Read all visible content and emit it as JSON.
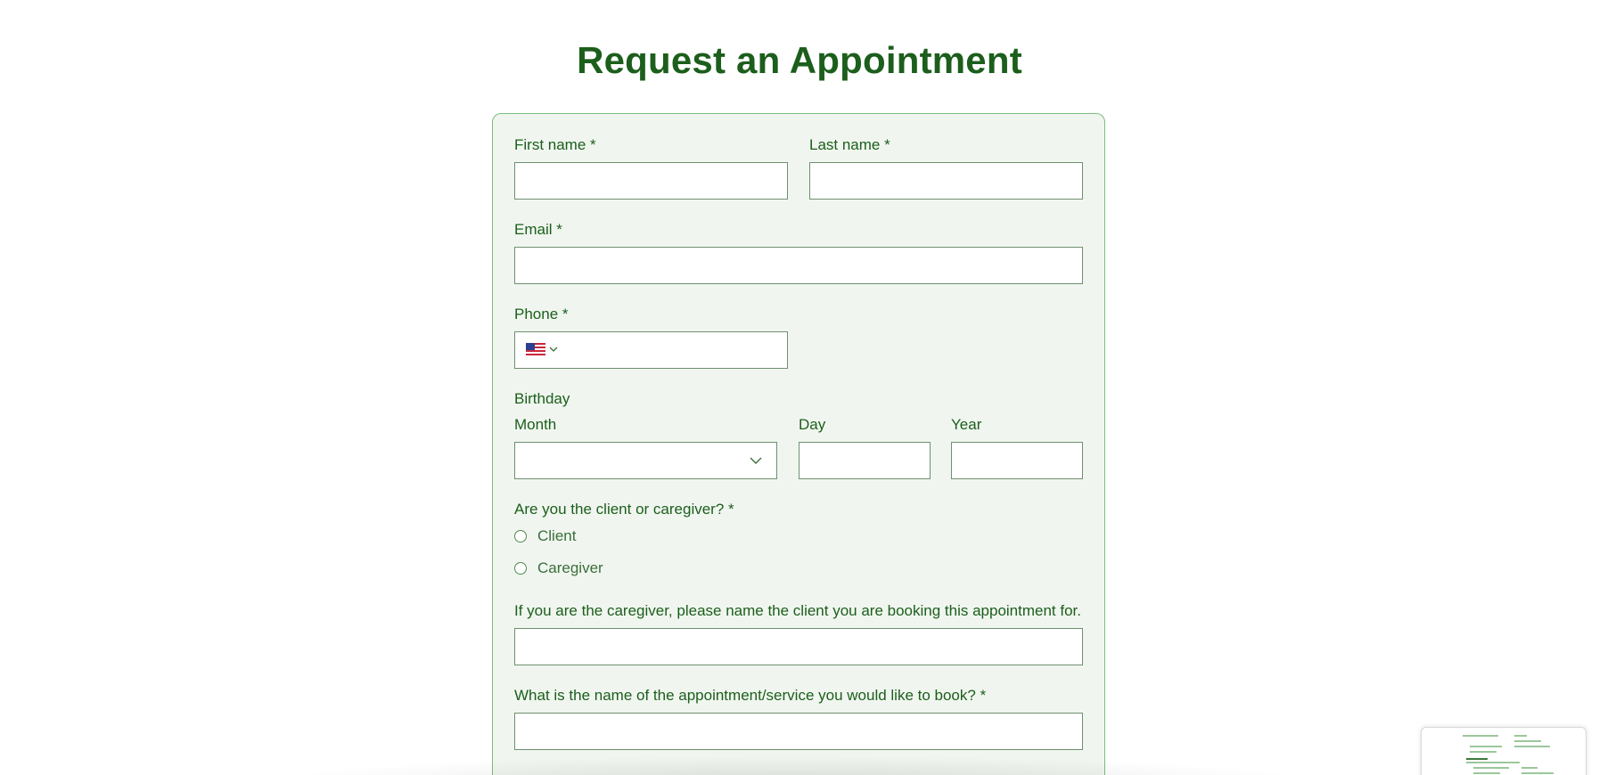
{
  "page": {
    "title": "Request an Appointment"
  },
  "form": {
    "first_name_label": "First name *",
    "last_name_label": "Last name *",
    "email_label": "Email *",
    "phone_label": "Phone *",
    "phone_country": "US",
    "birthday_label": "Birthday",
    "month_label": "Month",
    "day_label": "Day",
    "year_label": "Year",
    "role_question": "Are you the client or caregiver? *",
    "role_options": [
      "Client",
      "Caregiver"
    ],
    "caregiver_client_label": "If you are the caregiver, please name the client you are booking this appointment for.",
    "service_label": "What is the name of the appointment/service you would like to book? *",
    "first_name_value": "",
    "last_name_value": "",
    "email_value": "",
    "phone_value": "",
    "month_value": "",
    "day_value": "",
    "year_value": "",
    "caregiver_client_value": "",
    "service_value": ""
  },
  "colors": {
    "accent": "#1c5e1c",
    "card_background": "#f0f6ef",
    "card_border": "#7cbd7c"
  }
}
